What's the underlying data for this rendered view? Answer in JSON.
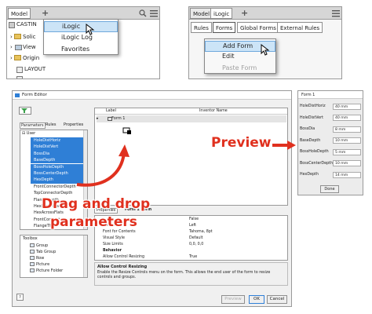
{
  "browser_panel": {
    "tabs": [
      "Model"
    ],
    "menu_items": [
      "iLogic",
      "iLogic Log",
      "Favorites"
    ],
    "tree": [
      "CASTIN",
      "Solic",
      "View",
      "Origin",
      "LAYOUT"
    ]
  },
  "ilogic_panel": {
    "tabs": [
      "Model",
      "iLogic"
    ],
    "subtabs": [
      "Rules",
      "Forms",
      "Global Forms",
      "External Rules"
    ],
    "context_menu": [
      "Add Form",
      "Edit",
      "Paste Form"
    ]
  },
  "form_editor": {
    "title": "Form Editor",
    "left_tabs": [
      "Parameters",
      "Rules",
      "Properties"
    ],
    "param_group": "User",
    "params": [
      {
        "name": "HoleDistHoriz",
        "selected": true
      },
      {
        "name": "HoleDistVert",
        "selected": true
      },
      {
        "name": "BossDia",
        "selected": true
      },
      {
        "name": "BaseDepth",
        "selected": true
      },
      {
        "name": "BossHoleDepth",
        "selected": true
      },
      {
        "name": "BossCenterDepth",
        "selected": true
      },
      {
        "name": "HexDepth",
        "selected": true
      },
      {
        "name": "FrontConnectorDepth",
        "selected": false
      },
      {
        "name": "TopConnectorDepth",
        "selected": false
      },
      {
        "name": "FlangeDepth",
        "selected": false
      },
      {
        "name": "HexMinorDia",
        "selected": false
      },
      {
        "name": "HexAcrossFlats",
        "selected": false
      },
      {
        "name": "FrontConnector",
        "selected": false
      },
      {
        "name": "FlangeThick",
        "selected": false
      }
    ],
    "toolbox_title": "Toolbox",
    "toolbox_items": [
      "Group",
      "Tab Group",
      "Row",
      "Picture",
      "Picture Folder"
    ],
    "tree_header_label": "Label",
    "tree_header_inventor": "Inventor Name",
    "form_node": "Form 1",
    "bottom_tabs": [
      "Properties",
      "Form 1 Form"
    ],
    "props": [
      {
        "name": "",
        "value": "False"
      },
      {
        "name": "Contents",
        "value": "Left"
      },
      {
        "name": "Font for Contents",
        "value": "Tahoma, 8pt"
      },
      {
        "name": "Visual Style",
        "value": "Default"
      },
      {
        "name": "Size Limits",
        "value": "0,0, 0,0"
      },
      {
        "name": "Behavior",
        "value": ""
      },
      {
        "name": "Allow Control Resizing",
        "value": "True"
      }
    ],
    "desc_title": "Allow Control Resizing",
    "desc_text": "Enable the Resize Controls menu on the form. This allows the end user of the form to resize controls and groups.",
    "buttons": [
      "Preview",
      "OK",
      "Cancel"
    ]
  },
  "preview_form": {
    "title": "Form 1",
    "fields": [
      {
        "label": "HoleDistHoriz",
        "value": "40 mm"
      },
      {
        "label": "HoleDistVert",
        "value": "40 mm"
      },
      {
        "label": "BossDia",
        "value": "8 mm"
      },
      {
        "label": "BaseDepth",
        "value": "10 mm"
      },
      {
        "label": "BossHoleDepth",
        "value": "5 mm"
      },
      {
        "label": "BossCenterDepth",
        "value": "10 mm"
      },
      {
        "label": "HexDepth",
        "value": "14 mm"
      }
    ],
    "done_label": "Done"
  },
  "annotations": {
    "preview": "Preview",
    "drag_line1": "Drag and drop",
    "drag_line2": "parameters"
  },
  "colors": {
    "accent": "#2f7fd6",
    "annotation": "#e0301e",
    "highlight": "#cce4f7"
  }
}
